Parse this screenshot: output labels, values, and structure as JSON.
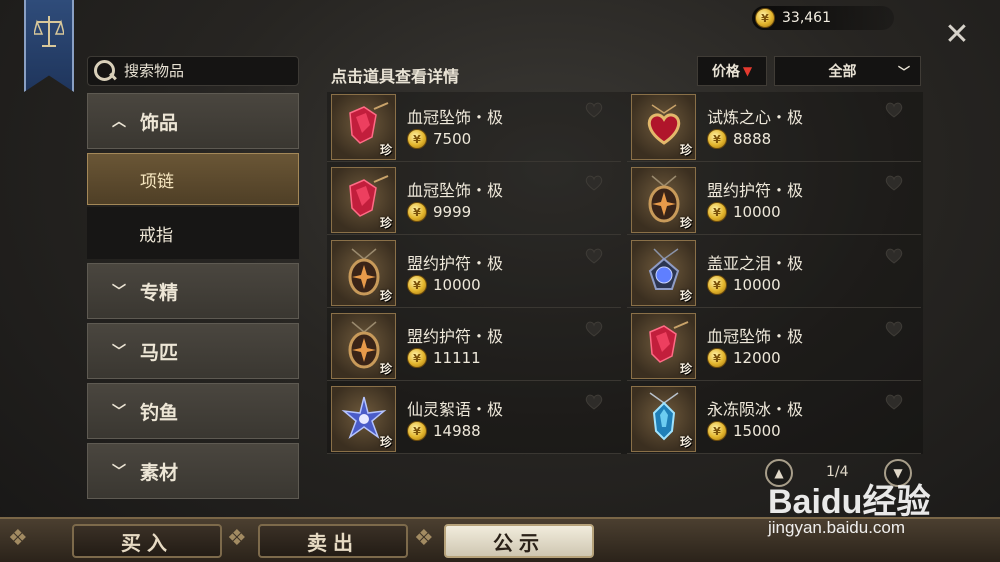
{
  "currency": {
    "amount": "33,461",
    "coin_icon": "gold-coin-icon"
  },
  "search": {
    "placeholder": "搜索物品"
  },
  "sidebar": {
    "categories": [
      {
        "label": "饰品",
        "expanded": true
      },
      {
        "label": "专精",
        "expanded": false
      },
      {
        "label": "马匹",
        "expanded": false
      },
      {
        "label": "钓鱼",
        "expanded": false
      },
      {
        "label": "素材",
        "expanded": false
      }
    ],
    "subitems": [
      {
        "label": "项链",
        "active": true
      },
      {
        "label": "戒指",
        "active": false
      }
    ]
  },
  "content": {
    "hint": "点击道具查看详情",
    "sort_label": "价格",
    "filter_label": "全部"
  },
  "items": [
    {
      "name": "血冠坠饰・极",
      "price": "7500",
      "tag": "珍",
      "gem": "crimson"
    },
    {
      "name": "试炼之心・极",
      "price": "8888",
      "tag": "珍",
      "gem": "heart"
    },
    {
      "name": "血冠坠饰・极",
      "price": "9999",
      "tag": "珍",
      "gem": "crimson"
    },
    {
      "name": "盟约护符・极",
      "price": "10000",
      "tag": "珍",
      "gem": "amulet"
    },
    {
      "name": "盟约护符・极",
      "price": "10000",
      "tag": "珍",
      "gem": "amulet"
    },
    {
      "name": "盖亚之泪・极",
      "price": "10000",
      "tag": "珍",
      "gem": "sapphire"
    },
    {
      "name": "盟约护符・极",
      "price": "11111",
      "tag": "珍",
      "gem": "amulet"
    },
    {
      "name": "血冠坠饰・极",
      "price": "12000",
      "tag": "珍",
      "gem": "crimson"
    },
    {
      "name": "仙灵絮语・极",
      "price": "14988",
      "tag": "珍",
      "gem": "flower"
    },
    {
      "name": "永冻陨冰・极",
      "price": "15000",
      "tag": "珍",
      "gem": "ice"
    }
  ],
  "pagination": {
    "page": "1/4"
  },
  "tabs": [
    {
      "label": "买入",
      "active": false
    },
    {
      "label": "卖出",
      "active": false
    },
    {
      "label": "公示",
      "active": true
    }
  ],
  "watermark": {
    "logo": "Baidu经验",
    "url": "jingyan.baidu.com"
  },
  "colors": {
    "accent_gold": "#a48858",
    "sort_arrow": "#e53a2f",
    "panel": "#3a3731"
  }
}
